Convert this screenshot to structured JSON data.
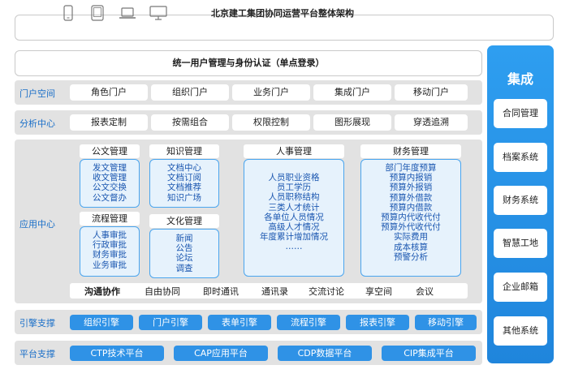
{
  "title": "北京建工集团协同运营平台整体架构",
  "device_icons": [
    "phone-icon",
    "tablet-icon",
    "laptop-icon",
    "monitor-icon"
  ],
  "sso": "统一用户管理与身份认证（单点登录）",
  "portal": {
    "label": "门户空间",
    "items": [
      "角色门户",
      "组织门户",
      "业务门户",
      "集成门户",
      "移动门户"
    ]
  },
  "analysis": {
    "label": "分析中心",
    "items": [
      "报表定制",
      "按需组合",
      "权限控制",
      "图形展现",
      "穿透追溯"
    ]
  },
  "app_center": {
    "label": "应用中心",
    "doc_mgmt": {
      "title": "公文管理",
      "items": [
        "发文管理",
        "收文管理",
        "公文交换",
        "公文督办"
      ]
    },
    "process_mgmt": {
      "title": "流程管理",
      "items": [
        "人事审批",
        "行政审批",
        "财务审批",
        "业务审批"
      ]
    },
    "knowledge_mgmt": {
      "title": "知识管理",
      "items": [
        "文档中心",
        "文档订阅",
        "文档推荐",
        "知识广场"
      ]
    },
    "culture_mgmt": {
      "title": "文化管理",
      "items": [
        "新闻",
        "公告",
        "论坛",
        "调查"
      ]
    },
    "hr_mgmt": {
      "title": "人事管理",
      "items": [
        "人员职业资格",
        "员工学历",
        "人员职称结构",
        "三类人才统计",
        "各单位人员情况",
        "高级人才情况",
        "年度累计增加情况",
        "……"
      ]
    },
    "finance_mgmt": {
      "title": "财务管理",
      "items": [
        "部门年度预算",
        "预算内报销",
        "预算外报销",
        "预算外借款",
        "预算内借款",
        "预算内代收代付",
        "预算外代收代付",
        "实际费用",
        "成本核算",
        "预警分析"
      ]
    },
    "communication": {
      "title": "沟通协作",
      "items": [
        "自由协同",
        "即时通讯",
        "通讯录",
        "交流讨论",
        "享空间",
        "会议"
      ]
    }
  },
  "engine": {
    "label": "引擎支撑",
    "items": [
      "组织引擎",
      "门户引擎",
      "表单引擎",
      "流程引擎",
      "报表引擎",
      "移动引擎"
    ]
  },
  "platform": {
    "label": "平台支撑",
    "items": [
      "CTP技术平台",
      "CAP应用平台",
      "CDP数据平台",
      "CIP集成平台"
    ]
  },
  "integration": {
    "title": "集成",
    "items": [
      "合同管理",
      "档案系统",
      "财务系统",
      "智慧工地",
      "企业邮箱",
      "其他系统"
    ]
  },
  "colors": {
    "accent": "#2f92e6",
    "band": "#e2e2e2",
    "label": "#1a6fc8",
    "module_border": "#4aa5ee"
  }
}
